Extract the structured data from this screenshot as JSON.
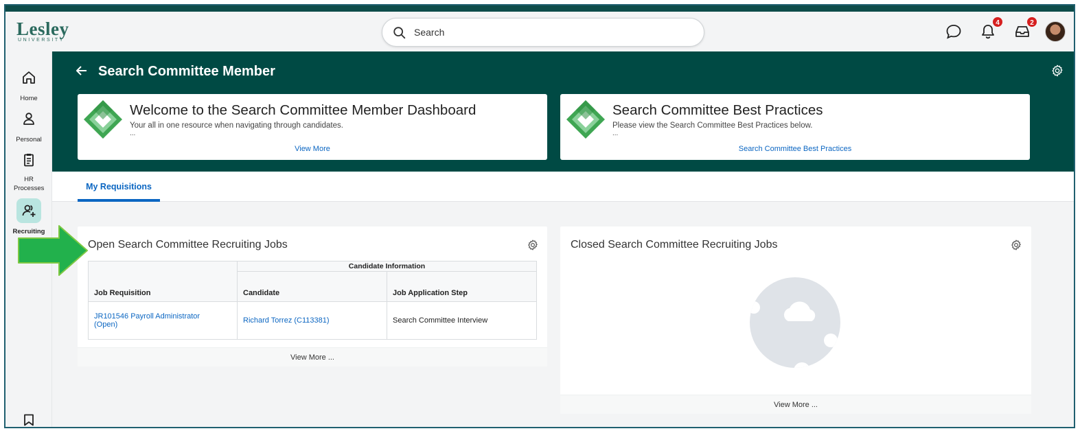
{
  "brand": {
    "name": "Lesley",
    "sub": "UNIVERSITY"
  },
  "search": {
    "placeholder": "Search"
  },
  "topbar": {
    "notifications_count": "4",
    "inbox_count": "2",
    "icons": [
      "chat-icon",
      "bell-icon",
      "inbox-icon"
    ]
  },
  "sidebar": {
    "items": [
      {
        "label": "Home",
        "icon": "home-icon"
      },
      {
        "label": "Personal",
        "icon": "person-icon"
      },
      {
        "label": "HR Processes",
        "icon": "clipboard-icon"
      },
      {
        "label": "Recruiting",
        "icon": "recruiting-icon",
        "active": true
      }
    ],
    "bottom_icon": "bookmark-icon"
  },
  "page": {
    "title": "Search Committee Member"
  },
  "promos": [
    {
      "title": "Welcome to the Search Committee Member Dashboard",
      "description": "Your all in one resource when navigating through candidates.",
      "ellipsis": "...",
      "link": "View More"
    },
    {
      "title": "Search Committee Best Practices",
      "description": "Please view the Search Committee Best Practices below.",
      "ellipsis": "...",
      "link": "Search Committee Best Practices"
    }
  ],
  "tabs": [
    {
      "label": "My Requisitions",
      "active": true
    }
  ],
  "open_jobs": {
    "title": "Open Search Committee Recruiting Jobs",
    "group_header": "Candidate Information",
    "columns": [
      "Job Requisition",
      "Candidate",
      "Job Application Step"
    ],
    "rows": [
      {
        "requisition_line1": "JR101546 Payroll Administrator",
        "requisition_line2": "(Open)",
        "candidate": "Richard Torrez (C113381)",
        "step": "Search Committee Interview"
      }
    ],
    "footer": "View More ..."
  },
  "closed_jobs": {
    "title": "Closed Search Committee Recruiting Jobs",
    "footer": "View More ..."
  },
  "colors": {
    "header_teal": "#004a44",
    "link_blue": "#0b66c2",
    "badge_red": "#d61f1f",
    "arrow_green": "#22b14c"
  }
}
